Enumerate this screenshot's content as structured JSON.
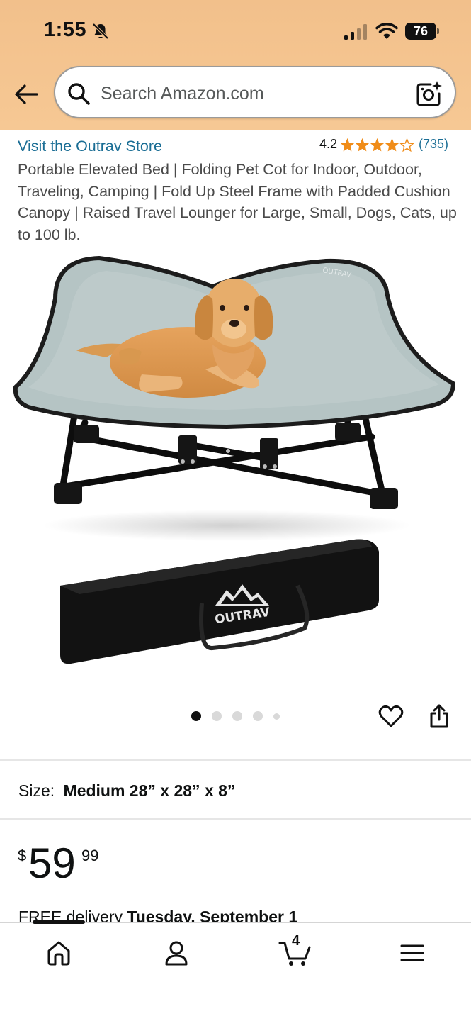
{
  "status_bar": {
    "time": "1:55",
    "battery": "76"
  },
  "search": {
    "placeholder": "Search Amazon.com"
  },
  "product": {
    "store_link": "Visit the Outrav Store",
    "rating": "4.2",
    "rating_stars": 4.2,
    "rating_count": "(735)",
    "title": "Portable Elevated Bed | Folding Pet Cot for Indoor, Outdoor, Traveling, Camping | Fold Up Steel Frame with Padded Cushion Canopy | Raised Travel Lounger for Large, Small, Dogs, Cats, up to 100 lb.",
    "image_count": 5,
    "image_active_index": 0,
    "bag_logo": "OUTRAV",
    "size_label": "Size:",
    "size_value": "Medium 28” x 28” x 8”",
    "price_symbol": "$",
    "price_whole": "59",
    "price_fraction": "99",
    "delivery_prefix": "FREE delivery",
    "delivery_date": "Tuesday, September 1"
  },
  "bottom_nav": {
    "cart_count": "4"
  },
  "colors": {
    "header_bg": "#f3c18d",
    "link": "#1b6e95",
    "star": "#f08c18",
    "text": "#0f1111"
  }
}
